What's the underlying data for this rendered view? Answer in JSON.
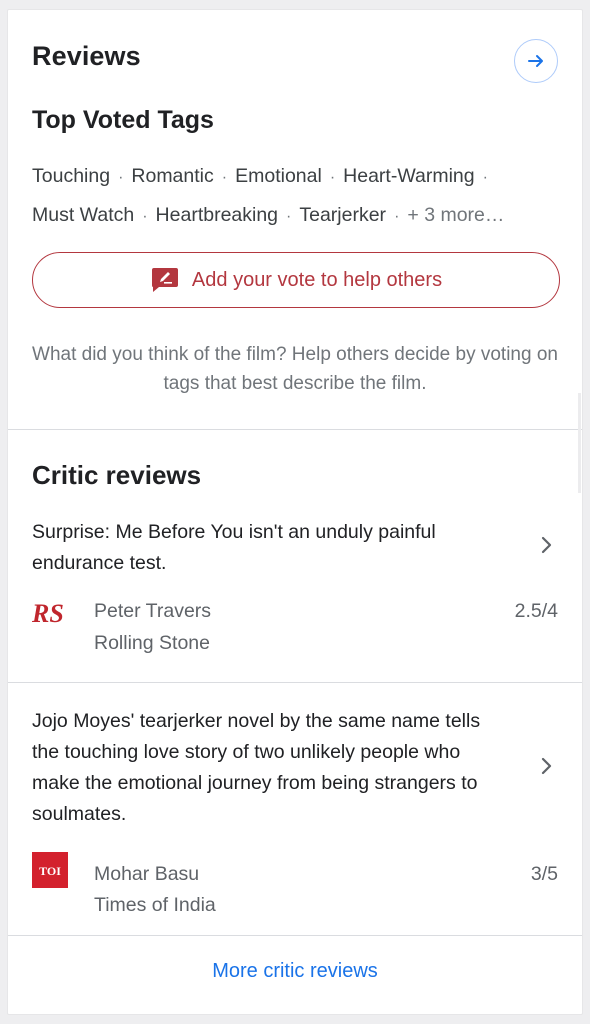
{
  "reviews": {
    "title": "Reviews",
    "arrow_icon": "arrow-right-icon"
  },
  "tags": {
    "title": "Top Voted Tags",
    "line1": [
      "Touching",
      "Romantic",
      "Emotional",
      "Heart-Warming"
    ],
    "line2": [
      "Must Watch",
      "Heartbreaking",
      "Tearjerker"
    ],
    "more": "+ 3 more…"
  },
  "vote": {
    "label": "Add your vote to help others",
    "icon": "edit-pencil-icon",
    "help_text": "What did you think of the film? Help others decide by voting on tags that best describe the film."
  },
  "critics": {
    "title": "Critic reviews",
    "items": [
      {
        "quote": "Surprise: Me Before You isn't an unduly painful endurance test.",
        "critic": "Peter Travers",
        "outlet": "Rolling Stone",
        "score": "2.5/4",
        "logo_text": "RS"
      },
      {
        "quote": "Jojo Moyes' tearjerker novel by the same name tells the touching love story of two unlikely people who make the emotional journey from being strangers to soulmates.",
        "critic": "Mohar Basu",
        "outlet": "Times of India",
        "score": "3/5",
        "logo_text": "TOI"
      }
    ],
    "more_link": "More critic reviews"
  },
  "colors": {
    "accent_red": "#b3373f",
    "link_blue": "#1a73e8",
    "toi_red": "#d3212d"
  }
}
